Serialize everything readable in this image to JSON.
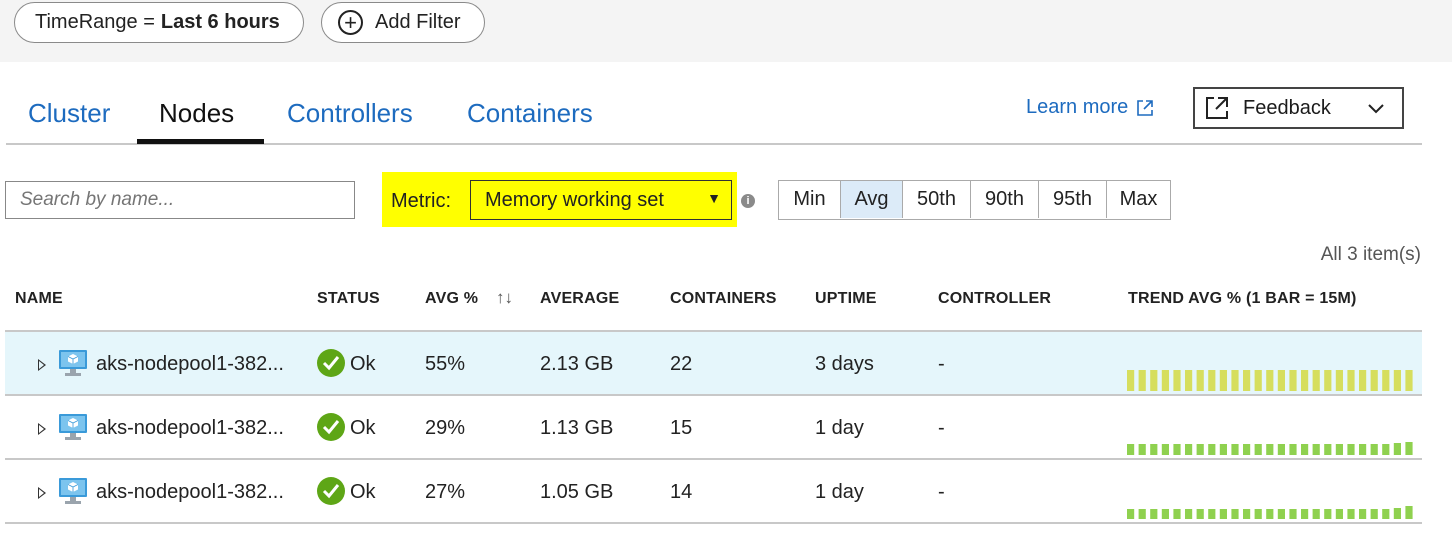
{
  "filters": {
    "time_range_key": "TimeRange =",
    "time_range_value": "Last 6 hours",
    "add_filter_label": "Add Filter"
  },
  "tabs": [
    {
      "label": "Cluster",
      "active": false
    },
    {
      "label": "Nodes",
      "active": true
    },
    {
      "label": "Controllers",
      "active": false
    },
    {
      "label": "Containers",
      "active": false
    }
  ],
  "learn_more_label": "Learn more",
  "feedback_label": "Feedback",
  "search": {
    "placeholder": "Search by name...",
    "value": ""
  },
  "metric": {
    "label": "Metric:",
    "selected": "Memory working set"
  },
  "percentiles": [
    {
      "label": "Min",
      "active": false
    },
    {
      "label": "Avg",
      "active": true
    },
    {
      "label": "50th",
      "active": false
    },
    {
      "label": "90th",
      "active": false
    },
    {
      "label": "95th",
      "active": false
    },
    {
      "label": "Max",
      "active": false
    }
  ],
  "items_count": "All 3 item(s)",
  "columns": {
    "name": "NAME",
    "status": "STATUS",
    "avg_pct": "AVG %",
    "average": "AVERAGE",
    "containers": "CONTAINERS",
    "uptime": "UPTIME",
    "controller": "CONTROLLER",
    "trend": "TREND AVG % (1 BAR = 15M)"
  },
  "rows": [
    {
      "name": "aks-nodepool1-382...",
      "status": "Ok",
      "avg_pct": "55%",
      "average": "2.13 GB",
      "containers": "22",
      "uptime": "3 days",
      "controller": "-",
      "trend_color": "#d6de5e",
      "trend_values": [
        55,
        55,
        55,
        55,
        55,
        55,
        55,
        55,
        55,
        55,
        55,
        55,
        55,
        55,
        55,
        55,
        55,
        55,
        55,
        55,
        55,
        55,
        55,
        55,
        56
      ]
    },
    {
      "name": "aks-nodepool1-382...",
      "status": "Ok",
      "avg_pct": "29%",
      "average": "1.13 GB",
      "containers": "15",
      "uptime": "1 day",
      "controller": "-",
      "trend_color": "#8fd14f",
      "trend_values": [
        29,
        29,
        29,
        29,
        29,
        29,
        29,
        29,
        29,
        29,
        29,
        29,
        29,
        29,
        29,
        29,
        29,
        29,
        29,
        29,
        29,
        29,
        29,
        31,
        33
      ]
    },
    {
      "name": "aks-nodepool1-382...",
      "status": "Ok",
      "avg_pct": "27%",
      "average": "1.05 GB",
      "containers": "14",
      "uptime": "1 day",
      "controller": "-",
      "trend_color": "#8fd14f",
      "trend_values": [
        27,
        27,
        27,
        27,
        27,
        27,
        27,
        27,
        27,
        27,
        27,
        27,
        27,
        27,
        27,
        27,
        27,
        27,
        27,
        27,
        27,
        27,
        27,
        30,
        33
      ]
    }
  ]
}
